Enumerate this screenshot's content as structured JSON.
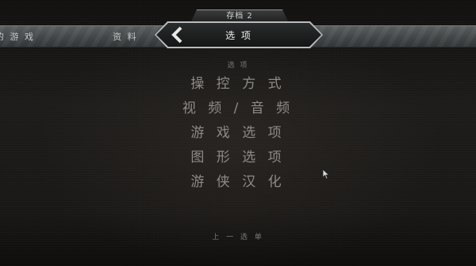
{
  "header": {
    "save_slot": "存档 2",
    "tabs_left": [
      "的 游 戏",
      "资 料"
    ],
    "active_tab": "选 项",
    "back_icon": "chevron-left-icon"
  },
  "main": {
    "section_title": "选 项",
    "menu_items": [
      "操 控 方 式",
      "视 频 / 音 频",
      "游 戏 选 项",
      "图 形 选 项",
      "游 侠 汉 化"
    ],
    "previous_menu": "上 一 选 单"
  },
  "colors": {
    "menu_text": "#8e8b87",
    "active_tab_border": "#b9bcbd",
    "background": "#1c1a18"
  }
}
